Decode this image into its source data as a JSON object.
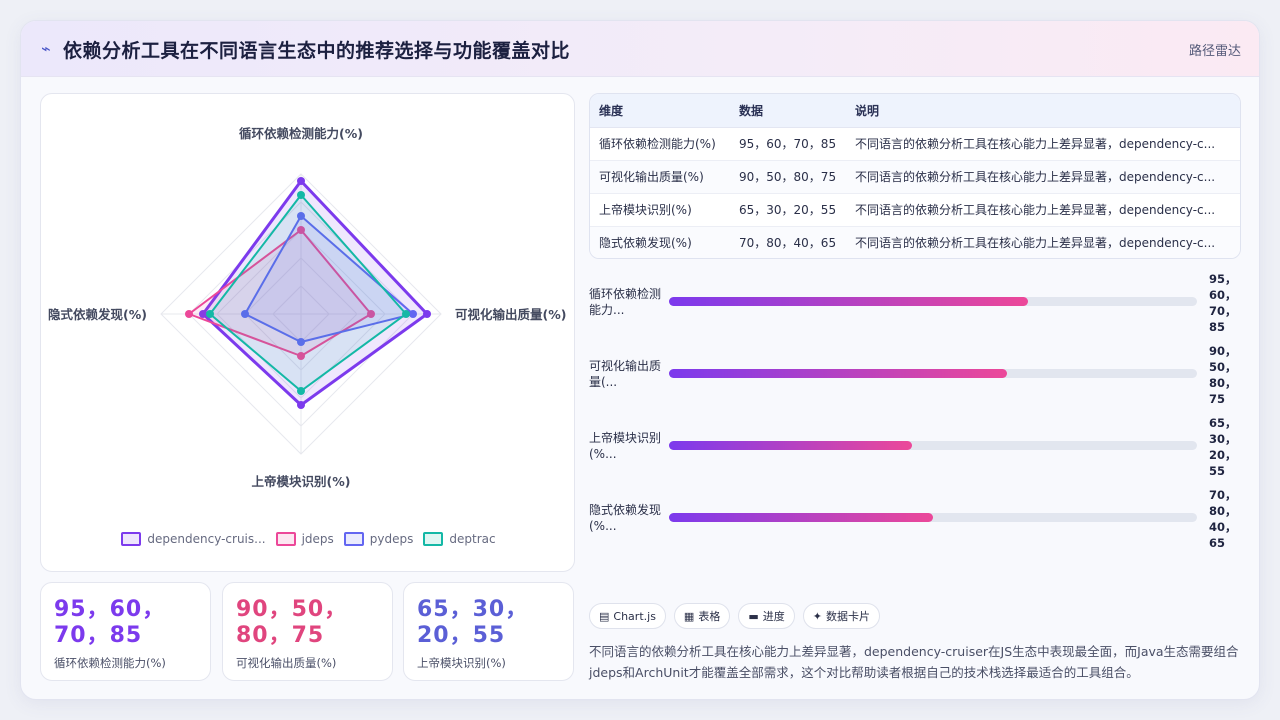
{
  "header": {
    "icon": "chart-line-icon",
    "title": "依赖分析工具在不同语言生态中的推荐选择与功能覆盖对比",
    "subtitle": "路径雷达"
  },
  "chart_data": {
    "type": "radar",
    "axes": [
      "循环依赖检测能力(%)",
      "可视化输出质量(%)",
      "上帝模块识别(%)",
      "隐式依赖发现(%)"
    ],
    "range": [
      0,
      100
    ],
    "series": [
      {
        "name": "dependency-cruis...",
        "values": [
          95,
          90,
          65,
          70
        ],
        "color": "#7c3aed"
      },
      {
        "name": "jdeps",
        "values": [
          60,
          50,
          30,
          80
        ],
        "color": "#ec4899"
      },
      {
        "name": "pydeps",
        "values": [
          70,
          80,
          20,
          40
        ],
        "color": "#6366f1"
      },
      {
        "name": "deptrac",
        "values": [
          85,
          75,
          55,
          65
        ],
        "color": "#14b8a6"
      }
    ],
    "legend_position": "bottom"
  },
  "stats": [
    {
      "value": "95，60，70，85",
      "label": "循环依赖检测能力(%)",
      "color": "#7c3aed"
    },
    {
      "value": "90，50，80，75",
      "label": "可视化输出质量(%)",
      "color": "#e0457e"
    },
    {
      "value": "65，30，20，55",
      "label": "上帝模块识别(%)",
      "color": "#5b5fd6"
    }
  ],
  "table": {
    "headers": [
      "维度",
      "数据",
      "说明"
    ],
    "rows": [
      [
        "循环依赖检测能力(%)",
        "95，60，70，85",
        "不同语言的依赖分析工具在核心能力上差异显著，dependency-c..."
      ],
      [
        "可视化输出质量(%)",
        "90，50，80，75",
        "不同语言的依赖分析工具在核心能力上差异显著，dependency-c..."
      ],
      [
        "上帝模块识别(%)",
        "65，30，20，55",
        "不同语言的依赖分析工具在核心能力上差异显著，dependency-c..."
      ],
      [
        "隐式依赖发现(%)",
        "70，80，40，65",
        "不同语言的依赖分析工具在核心能力上差异显著，dependency-c..."
      ]
    ]
  },
  "bars": [
    {
      "label": "循环依赖检测能力...",
      "value_lines": [
        "95，",
        "60，",
        "70，",
        "85"
      ],
      "fill": 0.68
    },
    {
      "label": "可视化输出质量(...",
      "value_lines": [
        "90，",
        "50，",
        "80，",
        "75"
      ],
      "fill": 0.64
    },
    {
      "label": "上帝模块识别(%...",
      "value_lines": [
        "65，",
        "30，",
        "20，",
        "55"
      ],
      "fill": 0.46
    },
    {
      "label": "隐式依赖发现(%...",
      "value_lines": [
        "70，",
        "80，",
        "40，",
        "65"
      ],
      "fill": 0.5
    }
  ],
  "toolbar": [
    {
      "icon": "chart-icon",
      "glyph": "▤",
      "label": "Chart.js"
    },
    {
      "icon": "table-icon",
      "glyph": "▦",
      "label": "表格"
    },
    {
      "icon": "progress-icon",
      "glyph": "▬",
      "label": "进度"
    },
    {
      "icon": "sparkle-icon",
      "glyph": "✦",
      "label": "数据卡片"
    }
  ],
  "footer": {
    "text": "不同语言的依赖分析工具在核心能力上差异显著，dependency-cruiser在JS生态中表现最全面，而Java生态需要组合jdeps和ArchUnit才能覆盖全部需求，这个对比帮助读者根据自己的技术栈选择最适合的工具组合。"
  }
}
